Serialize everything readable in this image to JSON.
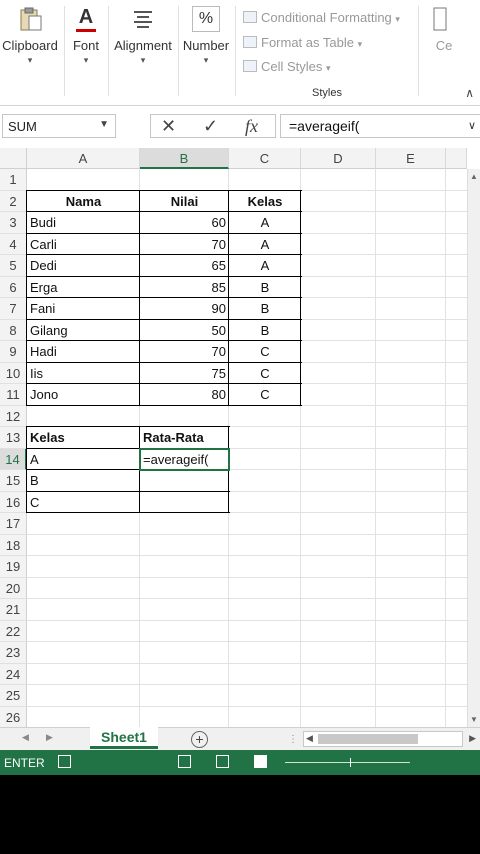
{
  "ribbon": {
    "clipboard": "Clipboard",
    "font": "Font",
    "alignment": "Alignment",
    "number": "Number",
    "number_symbol": "%",
    "font_symbol": "A",
    "conditional_formatting": "Conditional Formatting",
    "format_as_table": "Format as Table",
    "cell_styles": "Cell Styles",
    "styles_group": "Styles",
    "cells_partial": "Ce"
  },
  "formula_bar": {
    "name_box": "SUM",
    "cancel": "✕",
    "enter": "✓",
    "fx": "fx",
    "entry": "=averageif("
  },
  "columns": [
    "A",
    "B",
    "C",
    "D",
    "E"
  ],
  "rows": [
    "1",
    "2",
    "3",
    "4",
    "5",
    "6",
    "7",
    "8",
    "9",
    "10",
    "11",
    "12",
    "13",
    "14",
    "15",
    "16",
    "17",
    "18",
    "19",
    "20",
    "21",
    "22",
    "23",
    "24",
    "25",
    "26"
  ],
  "table": {
    "headers": [
      "Nama",
      "Nilai",
      "Kelas"
    ],
    "data": [
      [
        "Budi",
        "60",
        "A"
      ],
      [
        "Carli",
        "70",
        "A"
      ],
      [
        "Dedi",
        "65",
        "A"
      ],
      [
        "Erga",
        "85",
        "B"
      ],
      [
        "Fani",
        "90",
        "B"
      ],
      [
        "Gilang",
        "50",
        "B"
      ],
      [
        "Hadi",
        "70",
        "C"
      ],
      [
        "Iis",
        "75",
        "C"
      ],
      [
        "Jono",
        "80",
        "C"
      ]
    ]
  },
  "summary": {
    "headers": [
      "Kelas",
      "Rata-Rata"
    ],
    "classes": [
      "A",
      "B",
      "C"
    ],
    "active_value": "=averageif("
  },
  "sheet_tab": "Sheet1",
  "add_sheet": "+",
  "status": {
    "mode": "ENTER"
  }
}
